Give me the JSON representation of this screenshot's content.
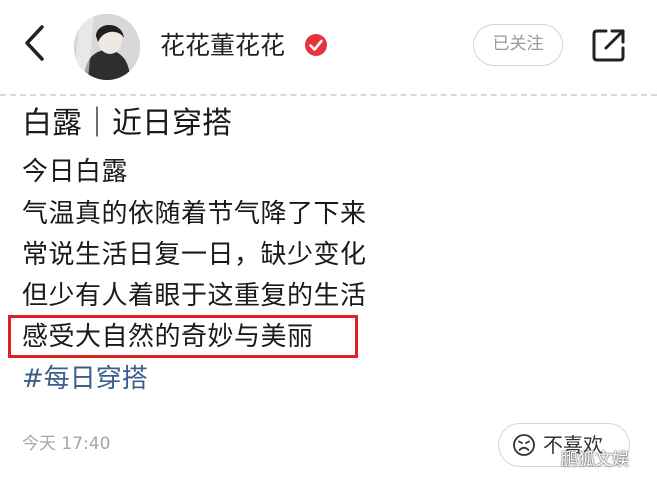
{
  "header": {
    "author_name": "花花董花花",
    "follow_label": "已关注",
    "icons": {
      "back": "back-arrow-icon",
      "verified": "verified-badge-icon",
      "share": "share-icon"
    },
    "colors": {
      "verified": "#e8323c"
    }
  },
  "post": {
    "title": "白露｜近日穿搭",
    "lines": [
      "今日白露",
      "气温真的依随着节气降了下来",
      "常说生活日复一日，缺少变化",
      "但少有人着眼于这重复的生活",
      "感受大自然的奇妙与美丽"
    ],
    "hashtag": "#每日穿搭",
    "highlight_color": "#e02020"
  },
  "footer": {
    "timestamp": "今天 17:40",
    "dislike_label": "不喜欢",
    "dislike_icon": "frown-face-icon"
  },
  "watermark": "鹏狐文娱"
}
